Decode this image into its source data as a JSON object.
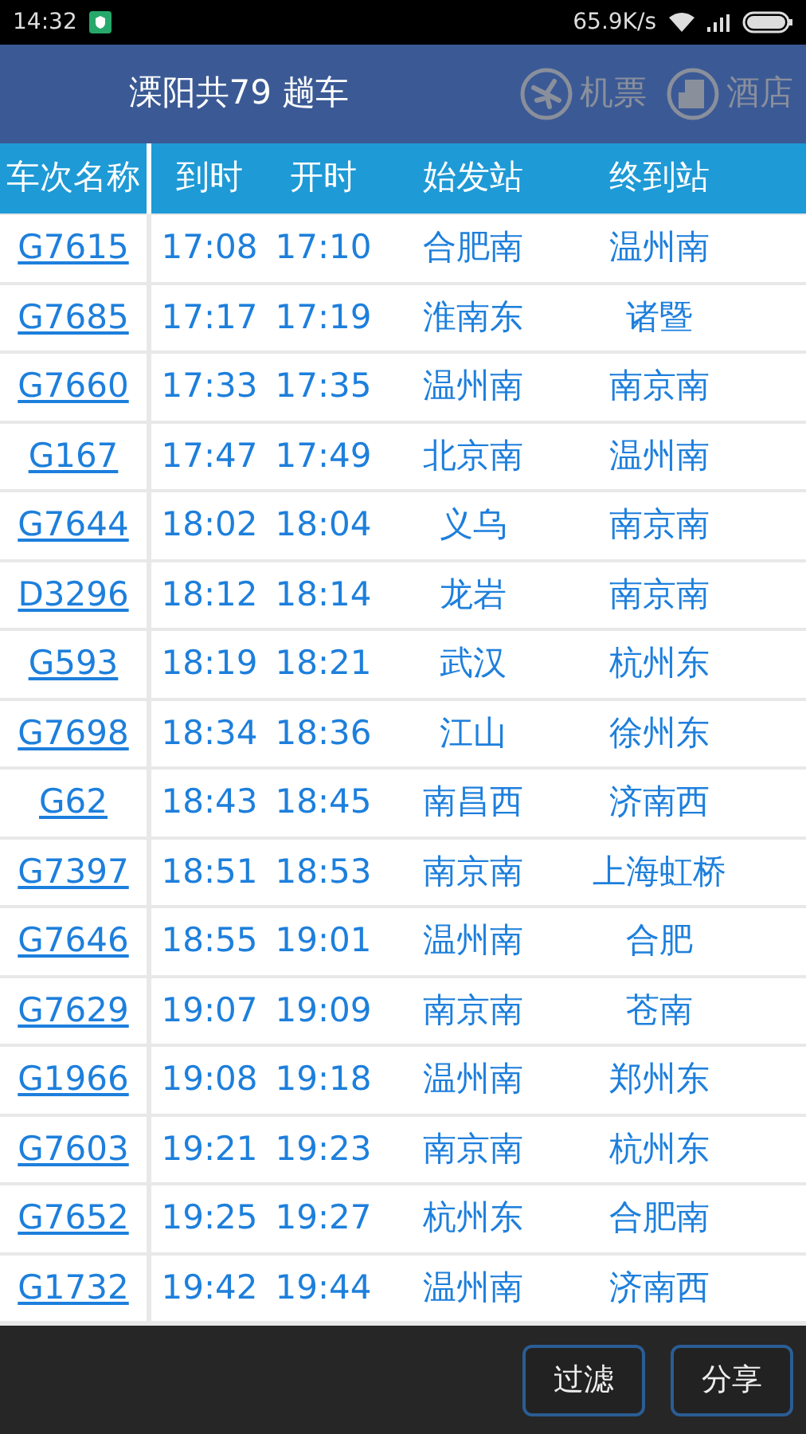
{
  "status_bar": {
    "time": "14:32",
    "speed": "65.9K/s"
  },
  "header": {
    "title": "溧阳共79 趟车",
    "actions": [
      "机票",
      "酒店"
    ]
  },
  "table": {
    "columns": [
      "车次名称",
      "到时",
      "开时",
      "始发站",
      "终到站"
    ],
    "rows": [
      [
        "G7615",
        "17:08",
        "17:10",
        "合肥南",
        "温州南"
      ],
      [
        "G7685",
        "17:17",
        "17:19",
        "淮南东",
        "诸暨"
      ],
      [
        "G7660",
        "17:33",
        "17:35",
        "温州南",
        "南京南"
      ],
      [
        "G167",
        "17:47",
        "17:49",
        "北京南",
        "温州南"
      ],
      [
        "G7644",
        "18:02",
        "18:04",
        "义乌",
        "南京南"
      ],
      [
        "D3296",
        "18:12",
        "18:14",
        "龙岩",
        "南京南"
      ],
      [
        "G593",
        "18:19",
        "18:21",
        "武汉",
        "杭州东"
      ],
      [
        "G7698",
        "18:34",
        "18:36",
        "江山",
        "徐州东"
      ],
      [
        "G62",
        "18:43",
        "18:45",
        "南昌西",
        "济南西"
      ],
      [
        "G7397",
        "18:51",
        "18:53",
        "南京南",
        "上海虹桥"
      ],
      [
        "G7646",
        "18:55",
        "19:01",
        "温州南",
        "合肥"
      ],
      [
        "G7629",
        "19:07",
        "19:09",
        "南京南",
        "苍南"
      ],
      [
        "G1966",
        "19:08",
        "19:18",
        "温州南",
        "郑州东"
      ],
      [
        "G7603",
        "19:21",
        "19:23",
        "南京南",
        "杭州东"
      ],
      [
        "G7652",
        "19:25",
        "19:27",
        "杭州东",
        "合肥南"
      ],
      [
        "G1732",
        "19:42",
        "19:44",
        "温州南",
        "济南西"
      ]
    ]
  },
  "bottom_bar": {
    "buttons": [
      "过滤",
      "分享"
    ]
  }
}
